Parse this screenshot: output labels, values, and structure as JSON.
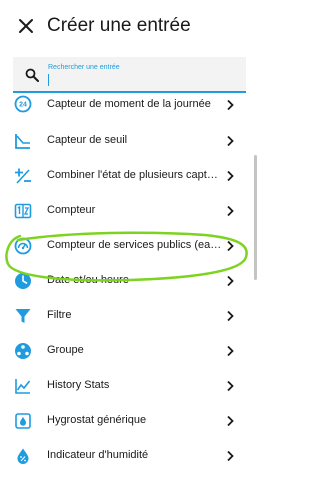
{
  "header": {
    "title": "Créer une entrée",
    "close_icon": "close-icon"
  },
  "search": {
    "label": "Rechercher une entrée",
    "value": "",
    "icon": "search-icon"
  },
  "accent_color": "#1f9be0",
  "highlight_color": "#7ed321",
  "items": [
    {
      "label": "Capteur de moment de la journée",
      "icon": "clock-24-icon"
    },
    {
      "label": "Capteur de seuil",
      "icon": "threshold-icon"
    },
    {
      "label": "Combiner l'état de plusieurs capteurs",
      "icon": "plus-minus-icon"
    },
    {
      "label": "Compteur",
      "icon": "counter-icon"
    },
    {
      "label": "Compteur de services publics (eau, gaz, électricité)",
      "icon": "gauge-icon"
    },
    {
      "label": "Date et/ou heure",
      "icon": "clock-icon"
    },
    {
      "label": "Filtre",
      "icon": "filter-icon"
    },
    {
      "label": "Groupe",
      "icon": "group-icon"
    },
    {
      "label": "History Stats",
      "icon": "chart-line-icon"
    },
    {
      "label": "Hygrostat générique",
      "icon": "hygrostat-icon"
    },
    {
      "label": "Indicateur d'humidité",
      "icon": "humidity-icon"
    }
  ]
}
